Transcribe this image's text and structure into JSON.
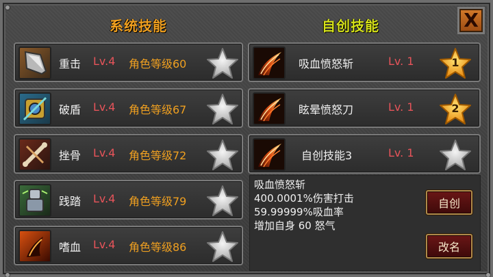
{
  "header": {
    "system_title": "系统技能",
    "custom_title": "自创技能",
    "close_label": "X"
  },
  "system_skills": [
    {
      "name": "重击",
      "level": "Lv.4",
      "requirement": "角色等级60",
      "icon": "blade-icon"
    },
    {
      "name": "破盾",
      "level": "Lv.4",
      "requirement": "角色等级67",
      "icon": "shield-icon"
    },
    {
      "name": "挫骨",
      "level": "Lv.4",
      "requirement": "角色等级72",
      "icon": "bone-break-icon"
    },
    {
      "name": "践踏",
      "level": "Lv.4",
      "requirement": "角色等级79",
      "icon": "stomp-knight-icon"
    },
    {
      "name": "嗜血",
      "level": "Lv.4",
      "requirement": "角色等级86",
      "icon": "bloodlust-icon"
    }
  ],
  "custom_skills": [
    {
      "name": "吸血愤怒斩",
      "level": "Lv. 1",
      "slot": "1",
      "icon": "fire-slash-icon"
    },
    {
      "name": "眩晕愤怒刀",
      "level": "Lv. 1",
      "slot": "2",
      "icon": "fire-slash-icon"
    },
    {
      "name": "自创技能3",
      "level": "Lv. 1",
      "slot": "",
      "icon": "fire-slash-icon"
    }
  ],
  "description": {
    "title": "吸血愤怒斩",
    "lines": [
      "400.0001%伤害打击",
      "59.99999%吸血率",
      "增加自身 60 怒气"
    ]
  },
  "buttons": {
    "create": "自创",
    "rename": "改名"
  },
  "colors": {
    "system_title": "#f0a020",
    "custom_title": "#d6e21a",
    "level": "#e8545a",
    "requirement": "#f0a020",
    "star_active": "#f5a623",
    "star_inactive": "#d8d8d8"
  }
}
